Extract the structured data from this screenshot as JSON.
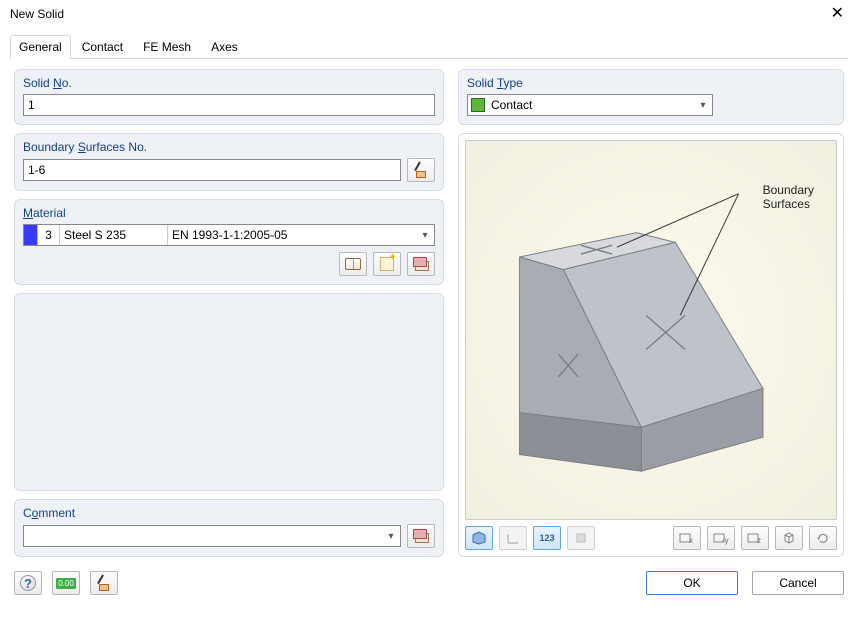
{
  "window": {
    "title": "New Solid"
  },
  "tabs": [
    {
      "label": "General",
      "active": true
    },
    {
      "label": "Contact",
      "active": false
    },
    {
      "label": "FE Mesh",
      "active": false
    },
    {
      "label": "Axes",
      "active": false
    }
  ],
  "left": {
    "solid_no": {
      "title_pre": "Solid ",
      "title_u": "N",
      "title_post": "o.",
      "value": "1"
    },
    "boundary": {
      "title_pre": "Boundary ",
      "title_u": "S",
      "title_post": "urfaces No.",
      "value": "1-6"
    },
    "material": {
      "title_u": "M",
      "title_post": "aterial",
      "num": "3",
      "name": "Steel S 235",
      "code": "EN 1993-1-1:2005-05"
    },
    "comment": {
      "title_pre": "C",
      "title_u": "o",
      "title_post": "mment",
      "value": ""
    }
  },
  "right": {
    "type": {
      "title_pre": "Solid ",
      "title_u": "T",
      "title_post": "ype",
      "value": "Contact"
    },
    "preview_label_l1": "Boundary",
    "preview_label_l2": "Surfaces",
    "toolbar_num": "123"
  },
  "footer": {
    "ok": "OK",
    "cancel": "Cancel",
    "calc": "0.00"
  }
}
